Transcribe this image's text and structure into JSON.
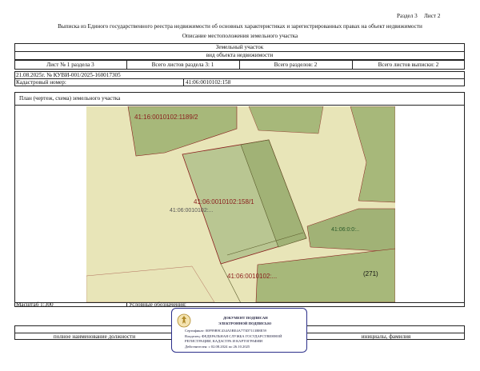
{
  "header": {
    "section_label": "Раздел 3",
    "sheet_label": "Лист 2",
    "title": "Выписка из Единого государственного реестра недвижимости об основных характеристиках и зарегистрированных правах на объект недвижимости",
    "subtitle": "Описание местоположения земельного участка"
  },
  "object": {
    "type": "Земельный участок",
    "type_caption": "вид объекта недвижимости"
  },
  "sheet_info": {
    "sheet_no": "Лист № 1 раздела 3",
    "total_section_sheets": "Всего листов раздела 3: 1",
    "total_sections": "Всего разделов: 2",
    "total_extract_sheets": "Всего листов выписки: 2"
  },
  "meta": {
    "date_number": "21.08.2025г. № КУВИ-001/2025-160017305",
    "cadastral_label": "Кадастровый номер:",
    "cadastral_value": "41:06:0010102:158"
  },
  "plan": {
    "title": "План (чертеж, схема) земельного участка",
    "labels": {
      "top_parcel": "41:16:0010102:1189/2",
      "main_parcel": "41:06:0010102:158/1",
      "main_parcel_sub": "41:06:0010102:...",
      "right_parcel": "41:06:0:0:..",
      "bottom_parcel": "41:06:0010102:...",
      "bottom_right": "(271)"
    },
    "colors": {
      "background": "#e8e5b8",
      "parcel_green": "#a7b87a",
      "main_parcel": "#b9c692",
      "highlight": "#a1b276",
      "boundary": "#8a1c1c",
      "text_red": "#8a1c1c"
    }
  },
  "footer": {
    "scale": "Масштаб 1:300",
    "legend": "Условные обозначения:",
    "position_caption": "полное наименование должности",
    "signature_caption": "инициалы, фамилия"
  },
  "stamp": {
    "line1": "ДОКУМЕНТ ПОДПИСАН",
    "line2": "ЭЛЕКТРОННОЙ ПОДПИСЬЮ",
    "cert": "Сертификат: 00F99B9C434A5BE4A775D7113B8E59",
    "owner": "Владелец: ФЕДЕРАЛЬНАЯ СЛУЖБА ГОСУДАРСТВЕННОЙ",
    "owner2": "РЕГИСТРАЦИИ, КАДАСТРА И КАРТОГРАФИИ",
    "valid": "Действителен: с 02.08.2024 по 26.10.2025"
  }
}
